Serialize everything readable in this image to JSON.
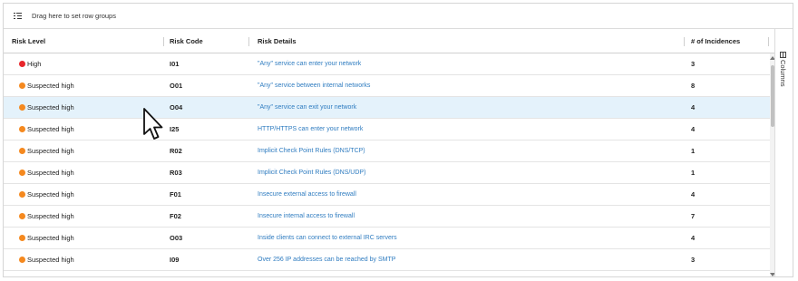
{
  "group_bar": {
    "text": "Drag here to set row groups",
    "icon": "row-groups-icon"
  },
  "columns": {
    "headers": [
      "Risk Level",
      "Risk Code",
      "Risk Details",
      "# of Incidences"
    ]
  },
  "side_panel": {
    "label": "Columns",
    "icon": "columns-icon"
  },
  "colors": {
    "high": "#e8262b",
    "suspected_high": "#f5891f",
    "link": "#2f7cc0",
    "selected_row": "#e4f2fb"
  },
  "rows": [
    {
      "level": "High",
      "severity": "high",
      "code": "I01",
      "details": "\"Any\" service can enter your network",
      "count": "3"
    },
    {
      "level": "Suspected high",
      "severity": "suspected_high",
      "code": "O01",
      "details": "\"Any\" service between internal networks",
      "count": "8"
    },
    {
      "level": "Suspected high",
      "severity": "suspected_high",
      "code": "O04",
      "details": "\"Any\" service can exit your network",
      "count": "4",
      "selected": true
    },
    {
      "level": "Suspected high",
      "severity": "suspected_high",
      "code": "I25",
      "details": "HTTP/HTTPS can enter your network",
      "count": "4"
    },
    {
      "level": "Suspected high",
      "severity": "suspected_high",
      "code": "R02",
      "details": "Implicit Check Point Rules (DNS/TCP)",
      "count": "1"
    },
    {
      "level": "Suspected high",
      "severity": "suspected_high",
      "code": "R03",
      "details": "Implicit Check Point Rules (DNS/UDP)",
      "count": "1"
    },
    {
      "level": "Suspected high",
      "severity": "suspected_high",
      "code": "F01",
      "details": "Insecure external access to firewall",
      "count": "4"
    },
    {
      "level": "Suspected high",
      "severity": "suspected_high",
      "code": "F02",
      "details": "Insecure internal access to firewall",
      "count": "7"
    },
    {
      "level": "Suspected high",
      "severity": "suspected_high",
      "code": "O03",
      "details": "Inside clients can connect to external IRC servers",
      "count": "4"
    },
    {
      "level": "Suspected high",
      "severity": "suspected_high",
      "code": "I09",
      "details": "Over 256 IP addresses can be reached by SMTP",
      "count": "3"
    }
  ]
}
